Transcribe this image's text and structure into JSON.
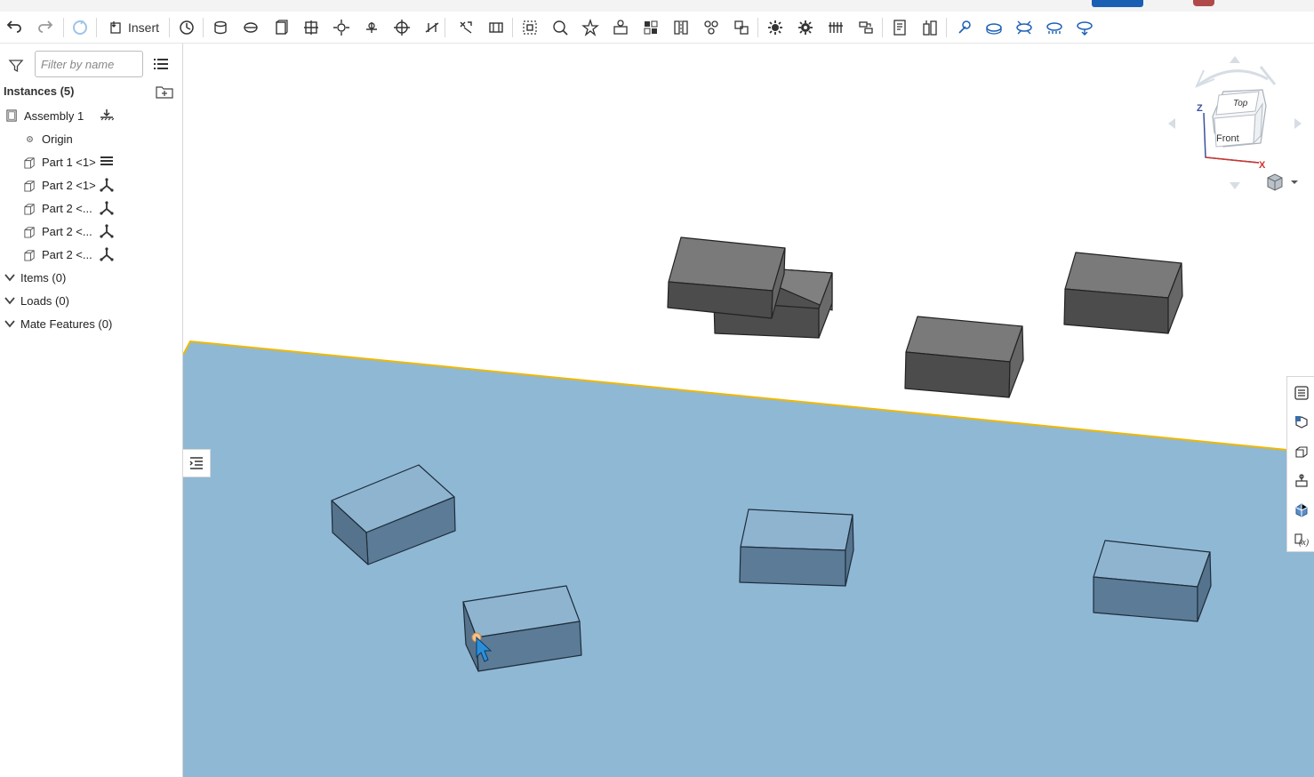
{
  "toolbar": {
    "insert_label": "Insert",
    "icons": [
      "undo-icon",
      "redo-icon",
      "refresh-icon",
      "insert-icon",
      "revolve-mate-icon",
      "cylinder-mate-icon",
      "slider-mate-icon",
      "planar-mate-icon",
      "fastened-mate-icon",
      "ball-mate-icon",
      "pin-slot-mate-icon",
      "revolute-mate-icon",
      "parallel-mate-icon",
      "tangent-mate-icon",
      "width-mate-icon",
      "group-icon",
      "mate-connector-icon",
      "relation-icon",
      "gear-relation-icon",
      "linear-pattern-icon",
      "replicate-icon",
      "mirror-icon",
      "assembly-pattern-icon",
      "explode-icon",
      "gear-icon",
      "gear-alt-icon",
      "rack-pinion-icon",
      "screw-icon",
      "bom-icon",
      "measure-icon",
      "section-view-icon",
      "orbit-icon",
      "zoom-icon",
      "view-fit-icon",
      "display-icon"
    ]
  },
  "panel": {
    "filter_placeholder": "Filter by name",
    "instances_header": "Instances (5)",
    "tree": [
      {
        "label": "Assembly 1",
        "icon": "assembly-icon",
        "mate": "ground-icon"
      },
      {
        "label": "Origin",
        "icon": "origin-icon",
        "mate": ""
      },
      {
        "label": "Part 1 <1>",
        "icon": "part-icon",
        "mate": "fixed-icon"
      },
      {
        "label": "Part 2 <1>",
        "icon": "part-icon",
        "mate": "dof-icon"
      },
      {
        "label": "Part 2 <...",
        "icon": "part-icon",
        "mate": "dof-icon"
      },
      {
        "label": "Part 2 <...",
        "icon": "part-icon",
        "mate": "dof-icon"
      },
      {
        "label": "Part 2 <...",
        "icon": "part-icon",
        "mate": "dof-icon"
      }
    ],
    "sections": [
      {
        "label": "Items (0)"
      },
      {
        "label": "Loads (0)"
      },
      {
        "label": "Mate Features (0)"
      }
    ]
  },
  "viewcube": {
    "top_label": "Top",
    "front_label": "Front",
    "z_label": "Z",
    "x_label": "X"
  },
  "colors": {
    "plate": "#8fb8d5",
    "plate_edge": "#f0b800",
    "gray_box": "#5a5a5a",
    "blue_box": "#5d7d99",
    "accent": "#1a5fb4"
  }
}
